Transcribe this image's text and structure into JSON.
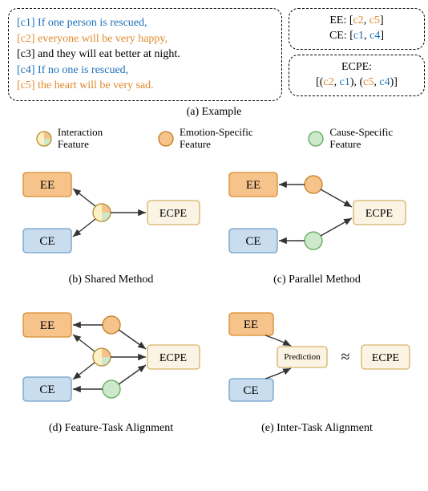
{
  "example": {
    "clauses": [
      {
        "tag": "[c1]",
        "text": "If one person is rescued,",
        "color": "blue"
      },
      {
        "tag": "[c2]",
        "text": "everyone will be very happy,",
        "color": "orange"
      },
      {
        "tag": "[c3]",
        "text": "and they will eat better at night.",
        "color": "black"
      },
      {
        "tag": "[c4]",
        "text": "If no one is rescued,",
        "color": "blue"
      },
      {
        "tag": "[c5]",
        "text": "the heart will be very sad.",
        "color": "orange"
      }
    ],
    "ee_label": "EE:",
    "ee_items": [
      "c2",
      "c5"
    ],
    "ce_label": "CE:",
    "ce_items": [
      "c1",
      "c4"
    ],
    "ecpe_label": "ECPE:",
    "ecpe_pairs": [
      [
        "c2",
        "c1"
      ],
      [
        "c5",
        "c4"
      ]
    ],
    "caption": "(a) Example"
  },
  "legend": {
    "interaction": "Interaction\nFeature",
    "emotion": "Emotion-Specific\nFeature",
    "cause": "Cause-Specific\nFeature"
  },
  "labels": {
    "EE": "EE",
    "CE": "CE",
    "ECPE": "ECPE",
    "Prediction": "Prediction",
    "approx": "≈"
  },
  "captions": {
    "b": "(b) Shared Method",
    "c": "(c) Parallel Method",
    "d": "(d) Feature-Task Alignment",
    "e": "(e) Inter-Task Alignment"
  },
  "colors": {
    "ee_fill": "#f6c38b",
    "ee_stroke": "#d98a2b",
    "ce_fill": "#c9ddee",
    "ce_stroke": "#6fa0c9",
    "ecpe_fill": "#fbf3e3",
    "ecpe_stroke": "#d6b36a",
    "emotion_node": "#f6c38b",
    "cause_node": "#cde8cb",
    "interaction_node": "#fdf0c6"
  },
  "chart_data": [
    {
      "id": "b",
      "name": "Shared Method",
      "nodes": [
        {
          "id": "EE",
          "type": "task"
        },
        {
          "id": "CE",
          "type": "task"
        },
        {
          "id": "ECPE",
          "type": "task"
        },
        {
          "id": "I",
          "type": "interaction"
        }
      ],
      "edges": [
        [
          "I",
          "EE"
        ],
        [
          "I",
          "CE"
        ],
        [
          "I",
          "ECPE"
        ]
      ]
    },
    {
      "id": "c",
      "name": "Parallel Method",
      "nodes": [
        {
          "id": "EE",
          "type": "task"
        },
        {
          "id": "CE",
          "type": "task"
        },
        {
          "id": "ECPE",
          "type": "task"
        },
        {
          "id": "E",
          "type": "emotion"
        },
        {
          "id": "C",
          "type": "cause"
        }
      ],
      "edges": [
        [
          "E",
          "EE"
        ],
        [
          "C",
          "CE"
        ],
        [
          "E",
          "ECPE"
        ],
        [
          "C",
          "ECPE"
        ]
      ]
    },
    {
      "id": "d",
      "name": "Feature-Task Alignment",
      "nodes": [
        {
          "id": "EE",
          "type": "task"
        },
        {
          "id": "CE",
          "type": "task"
        },
        {
          "id": "ECPE",
          "type": "task"
        },
        {
          "id": "E",
          "type": "emotion"
        },
        {
          "id": "C",
          "type": "cause"
        },
        {
          "id": "I",
          "type": "interaction"
        }
      ],
      "edges": [
        [
          "E",
          "EE"
        ],
        [
          "C",
          "CE"
        ],
        [
          "I",
          "EE"
        ],
        [
          "I",
          "CE"
        ],
        [
          "E",
          "ECPE"
        ],
        [
          "C",
          "ECPE"
        ],
        [
          "I",
          "ECPE"
        ]
      ]
    },
    {
      "id": "e",
      "name": "Inter-Task Alignment",
      "nodes": [
        {
          "id": "EE",
          "type": "task"
        },
        {
          "id": "CE",
          "type": "task"
        },
        {
          "id": "ECPE",
          "type": "task"
        },
        {
          "id": "P",
          "type": "prediction"
        }
      ],
      "edges": [
        [
          "EE",
          "P"
        ],
        [
          "CE",
          "P"
        ]
      ],
      "relation": {
        "from": "P",
        "to": "ECPE",
        "op": "approx"
      }
    }
  ]
}
